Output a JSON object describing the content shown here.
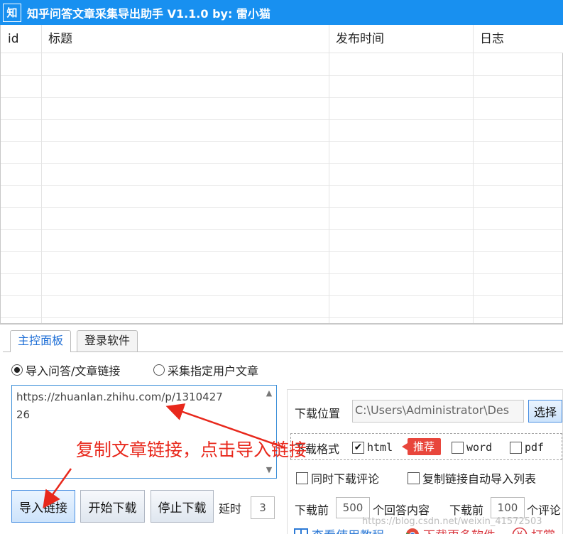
{
  "window": {
    "icon_char": "知",
    "title": "知乎问答文章采集导出助手 V1.1.0  by: 雷小猫"
  },
  "grid": {
    "columns": [
      "id",
      "标题",
      "发布时间",
      "日志"
    ]
  },
  "tabs": [
    "主控面板",
    "登录软件"
  ],
  "source": {
    "radio_import": "导入问答/文章链接",
    "radio_user": "采集指定用户文章",
    "url_value": "https://zhuanlan.zhihu.com/p/1310427\n26"
  },
  "buttons": {
    "import": "导入链接",
    "start": "开始下载",
    "stop": "停止下载",
    "choose": "选择"
  },
  "delay": {
    "label": "延时",
    "value": "3"
  },
  "settings": {
    "location_label": "下载位置",
    "location_value": "C:\\Users\\Administrator\\Des",
    "format_label": "下载格式",
    "formats": [
      {
        "label": "html",
        "checked": true
      },
      {
        "label": "word",
        "checked": false
      },
      {
        "label": "pdf",
        "checked": false
      }
    ],
    "badge": "推荐",
    "download_comments": "同时下载评论",
    "auto_import": "复制链接自动导入列表",
    "before_answers_prefix": "下载前",
    "answers_count": "500",
    "answers_suffix": "个回答内容",
    "before_comments_prefix": "下载前",
    "comments_count": "100",
    "comments_suffix": "个评论"
  },
  "links": {
    "tutorial": "查看使用教程",
    "more": "下载更多软件",
    "donate": "打赏"
  },
  "annotation": "复制文章链接，点击导入链接",
  "watermark": "https://blog.csdn.net/weixin_41572503"
}
